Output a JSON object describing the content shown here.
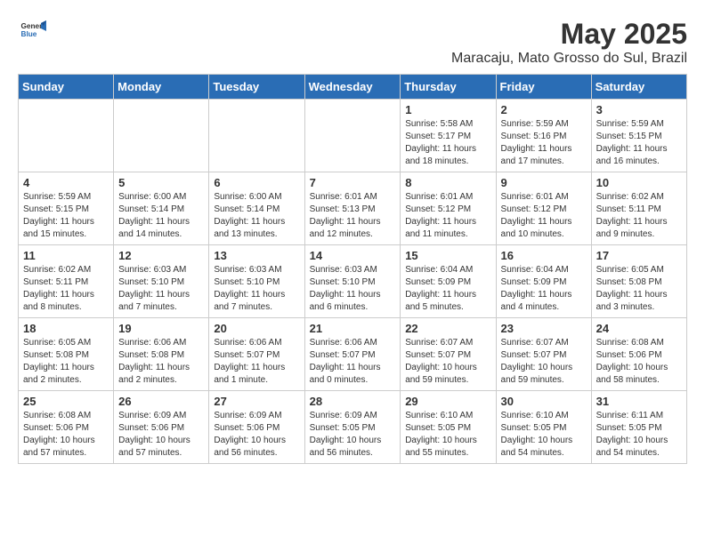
{
  "logo": {
    "general": "General",
    "blue": "Blue"
  },
  "title": "May 2025",
  "subtitle": "Maracaju, Mato Grosso do Sul, Brazil",
  "days_header": [
    "Sunday",
    "Monday",
    "Tuesday",
    "Wednesday",
    "Thursday",
    "Friday",
    "Saturday"
  ],
  "weeks": [
    [
      {
        "day": "",
        "info": ""
      },
      {
        "day": "",
        "info": ""
      },
      {
        "day": "",
        "info": ""
      },
      {
        "day": "",
        "info": ""
      },
      {
        "day": "1",
        "info": "Sunrise: 5:58 AM\nSunset: 5:17 PM\nDaylight: 11 hours and 18 minutes."
      },
      {
        "day": "2",
        "info": "Sunrise: 5:59 AM\nSunset: 5:16 PM\nDaylight: 11 hours and 17 minutes."
      },
      {
        "day": "3",
        "info": "Sunrise: 5:59 AM\nSunset: 5:15 PM\nDaylight: 11 hours and 16 minutes."
      }
    ],
    [
      {
        "day": "4",
        "info": "Sunrise: 5:59 AM\nSunset: 5:15 PM\nDaylight: 11 hours and 15 minutes."
      },
      {
        "day": "5",
        "info": "Sunrise: 6:00 AM\nSunset: 5:14 PM\nDaylight: 11 hours and 14 minutes."
      },
      {
        "day": "6",
        "info": "Sunrise: 6:00 AM\nSunset: 5:14 PM\nDaylight: 11 hours and 13 minutes."
      },
      {
        "day": "7",
        "info": "Sunrise: 6:01 AM\nSunset: 5:13 PM\nDaylight: 11 hours and 12 minutes."
      },
      {
        "day": "8",
        "info": "Sunrise: 6:01 AM\nSunset: 5:12 PM\nDaylight: 11 hours and 11 minutes."
      },
      {
        "day": "9",
        "info": "Sunrise: 6:01 AM\nSunset: 5:12 PM\nDaylight: 11 hours and 10 minutes."
      },
      {
        "day": "10",
        "info": "Sunrise: 6:02 AM\nSunset: 5:11 PM\nDaylight: 11 hours and 9 minutes."
      }
    ],
    [
      {
        "day": "11",
        "info": "Sunrise: 6:02 AM\nSunset: 5:11 PM\nDaylight: 11 hours and 8 minutes."
      },
      {
        "day": "12",
        "info": "Sunrise: 6:03 AM\nSunset: 5:10 PM\nDaylight: 11 hours and 7 minutes."
      },
      {
        "day": "13",
        "info": "Sunrise: 6:03 AM\nSunset: 5:10 PM\nDaylight: 11 hours and 7 minutes."
      },
      {
        "day": "14",
        "info": "Sunrise: 6:03 AM\nSunset: 5:10 PM\nDaylight: 11 hours and 6 minutes."
      },
      {
        "day": "15",
        "info": "Sunrise: 6:04 AM\nSunset: 5:09 PM\nDaylight: 11 hours and 5 minutes."
      },
      {
        "day": "16",
        "info": "Sunrise: 6:04 AM\nSunset: 5:09 PM\nDaylight: 11 hours and 4 minutes."
      },
      {
        "day": "17",
        "info": "Sunrise: 6:05 AM\nSunset: 5:08 PM\nDaylight: 11 hours and 3 minutes."
      }
    ],
    [
      {
        "day": "18",
        "info": "Sunrise: 6:05 AM\nSunset: 5:08 PM\nDaylight: 11 hours and 2 minutes."
      },
      {
        "day": "19",
        "info": "Sunrise: 6:06 AM\nSunset: 5:08 PM\nDaylight: 11 hours and 2 minutes."
      },
      {
        "day": "20",
        "info": "Sunrise: 6:06 AM\nSunset: 5:07 PM\nDaylight: 11 hours and 1 minute."
      },
      {
        "day": "21",
        "info": "Sunrise: 6:06 AM\nSunset: 5:07 PM\nDaylight: 11 hours and 0 minutes."
      },
      {
        "day": "22",
        "info": "Sunrise: 6:07 AM\nSunset: 5:07 PM\nDaylight: 10 hours and 59 minutes."
      },
      {
        "day": "23",
        "info": "Sunrise: 6:07 AM\nSunset: 5:07 PM\nDaylight: 10 hours and 59 minutes."
      },
      {
        "day": "24",
        "info": "Sunrise: 6:08 AM\nSunset: 5:06 PM\nDaylight: 10 hours and 58 minutes."
      }
    ],
    [
      {
        "day": "25",
        "info": "Sunrise: 6:08 AM\nSunset: 5:06 PM\nDaylight: 10 hours and 57 minutes."
      },
      {
        "day": "26",
        "info": "Sunrise: 6:09 AM\nSunset: 5:06 PM\nDaylight: 10 hours and 57 minutes."
      },
      {
        "day": "27",
        "info": "Sunrise: 6:09 AM\nSunset: 5:06 PM\nDaylight: 10 hours and 56 minutes."
      },
      {
        "day": "28",
        "info": "Sunrise: 6:09 AM\nSunset: 5:05 PM\nDaylight: 10 hours and 56 minutes."
      },
      {
        "day": "29",
        "info": "Sunrise: 6:10 AM\nSunset: 5:05 PM\nDaylight: 10 hours and 55 minutes."
      },
      {
        "day": "30",
        "info": "Sunrise: 6:10 AM\nSunset: 5:05 PM\nDaylight: 10 hours and 54 minutes."
      },
      {
        "day": "31",
        "info": "Sunrise: 6:11 AM\nSunset: 5:05 PM\nDaylight: 10 hours and 54 minutes."
      }
    ]
  ]
}
